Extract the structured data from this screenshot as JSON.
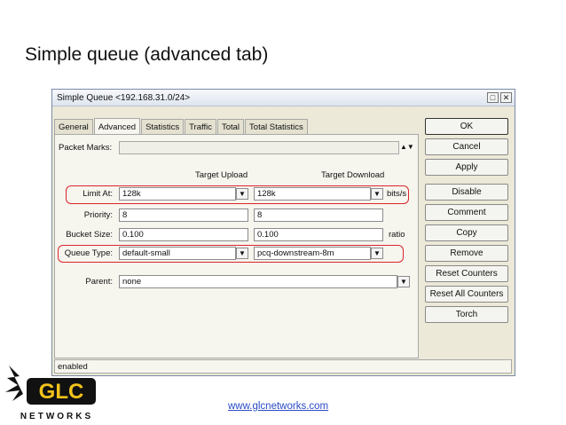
{
  "slide": {
    "title": "Simple queue (advanced tab)",
    "footer_url": "www.glcnetworks.com",
    "logo_text": "NETWORKS"
  },
  "window": {
    "title": "Simple Queue <192.168.31.0/24>",
    "tabs": [
      "General",
      "Advanced",
      "Statistics",
      "Traffic",
      "Total",
      "Total Statistics"
    ],
    "active_tab": "Advanced",
    "status": "enabled"
  },
  "form": {
    "packet_marks_label": "Packet Marks:",
    "target_upload_header": "Target Upload",
    "target_download_header": "Target Download",
    "limit_at": {
      "label": "Limit At:",
      "upload": "128k",
      "download": "128k",
      "unit": "bits/s"
    },
    "priority": {
      "label": "Priority:",
      "upload": "8",
      "download": "8"
    },
    "bucket_size": {
      "label": "Bucket Size:",
      "upload": "0.100",
      "download": "0.100",
      "unit": "ratio"
    },
    "queue_type": {
      "label": "Queue Type:",
      "upload": "default-small",
      "download": "pcq-downstream-8m"
    },
    "parent": {
      "label": "Parent:",
      "value": "none"
    }
  },
  "buttons": [
    "OK",
    "Cancel",
    "Apply",
    "Disable",
    "Comment",
    "Copy",
    "Remove",
    "Reset Counters",
    "Reset All Counters",
    "Torch"
  ],
  "colors": {
    "highlight": "#d9262c",
    "link": "#2a4bc6",
    "window_bg": "#ece9d8"
  }
}
